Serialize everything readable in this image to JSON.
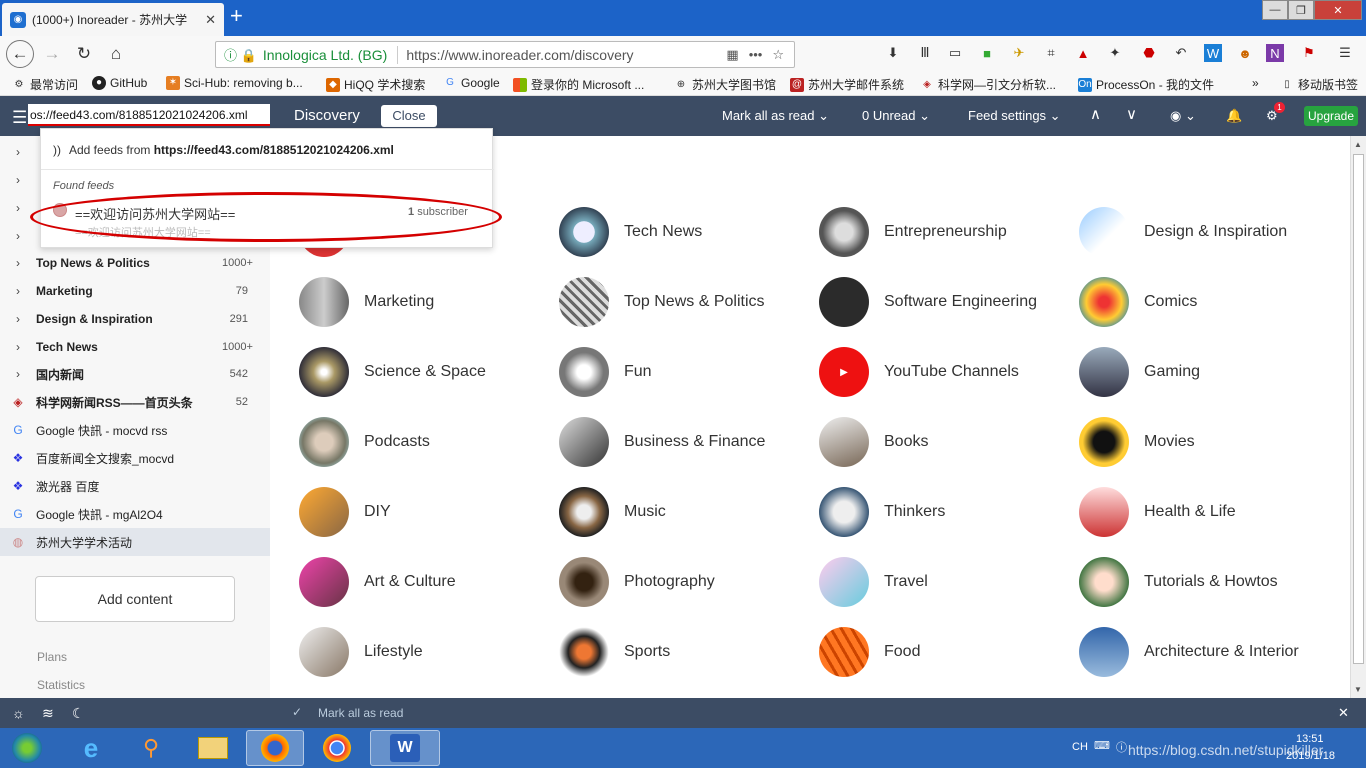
{
  "browser": {
    "tab_title": "(1000+) Inoreader - 苏州大学",
    "new_tab": "+",
    "url_org": "Innologica Ltd. (BG)",
    "url": "https://www.inoreader.com/discovery",
    "bookmarks": [
      "最常访问",
      "GitHub",
      "Sci-Hub: removing b...",
      "HiQQ 学术搜索",
      "Google",
      "登录你的 Microsoft ...",
      "苏州大学图书馆",
      "苏州大学邮件系统",
      "科学网—引文分析软...",
      "ProcessOn - 我的文件",
      "移动版书签"
    ]
  },
  "header": {
    "feed_input_value": "os://feed43.com/8188512021024206.xml",
    "discovery_label": "Discovery",
    "close_label": "Close",
    "mark_all_read": "Mark all as read",
    "unread": "0 Unread",
    "feed_settings": "Feed settings",
    "upgrade": "Upgrade",
    "gear_badge": "1"
  },
  "dropdown": {
    "add_prefix": "Add feeds from",
    "add_url": "https://feed43.com/8188512021024206.xml",
    "found_feeds": "Found feeds",
    "feed_title": "==欢迎访问苏州大学网站==",
    "subscriber_count": "1",
    "subscriber_label": "subscriber",
    "feed_desc": "==欢迎访问苏州大学网站=="
  },
  "sidebar": {
    "items": [
      {
        "label": "Top News & Politics",
        "count": "1000+"
      },
      {
        "label": "Marketing",
        "count": "79"
      },
      {
        "label": "Design & Inspiration",
        "count": "291"
      },
      {
        "label": "Tech News",
        "count": "1000+"
      },
      {
        "label": "国内新闻",
        "count": "542"
      },
      {
        "label": "科学网新闻RSS——首页头条",
        "count": "52"
      },
      {
        "label": "Google 快訊 - mocvd rss",
        "count": ""
      },
      {
        "label": "百度新闻全文搜索_mocvd",
        "count": ""
      },
      {
        "label": "激光器 百度",
        "count": ""
      },
      {
        "label": "Google 快訊 - mgAl2O4",
        "count": ""
      },
      {
        "label": "苏州大学学术活动",
        "count": ""
      }
    ],
    "add_content": "Add content",
    "plans": "Plans",
    "statistics": "Statistics"
  },
  "categories": [
    "Tech News",
    "Entrepreneurship",
    "Design & Inspiration",
    "Marketing",
    "Top News & Politics",
    "Software Engineering",
    "Comics",
    "Science & Space",
    "Fun",
    "YouTube Channels",
    "Gaming",
    "Podcasts",
    "Business & Finance",
    "Books",
    "Movies",
    "DIY",
    "Music",
    "Thinkers",
    "Health & Life",
    "Art & Culture",
    "Photography",
    "Travel",
    "Tutorials & Howtos",
    "Lifestyle",
    "Sports",
    "Food",
    "Architecture & Interior"
  ],
  "footer": {
    "mark_all_read": "Mark all as read"
  },
  "taskbar": {
    "lang": "CH",
    "time": "13:51",
    "date": "2019/1/18",
    "watermark": "https://blog.csdn.net/stupidkiller"
  }
}
